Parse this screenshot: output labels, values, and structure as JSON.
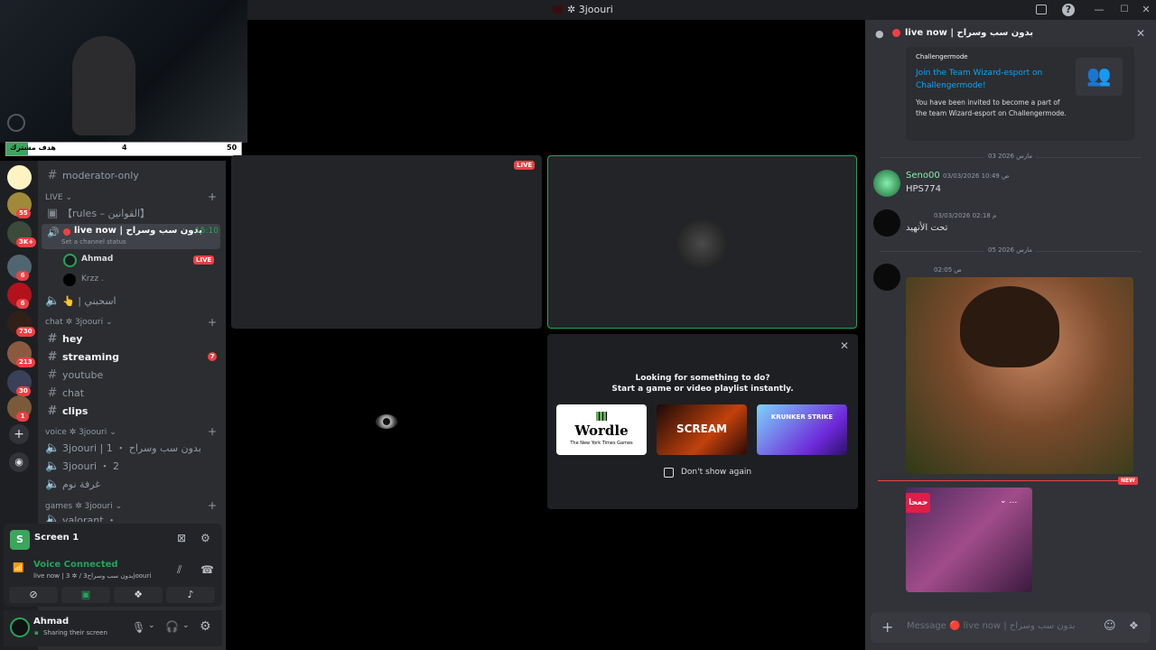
{
  "window": {
    "title": "✲ 3joouri"
  },
  "subscriber_bar": {
    "label": "هدف مشترك",
    "current": "4",
    "goal": "50"
  },
  "rail": {
    "servers": [
      {
        "color": "#fff3c4",
        "badge": ""
      },
      {
        "color": "#a08a3a",
        "badge": "55"
      },
      {
        "color": "#3b4a3a",
        "badge": "3K+"
      },
      {
        "color": "#4f6670",
        "badge": "6"
      },
      {
        "color": "#b2121b",
        "badge": "6"
      },
      {
        "color": "#2f2018",
        "badge": "730"
      },
      {
        "color": "#8a5a40",
        "badge": "213"
      },
      {
        "color": "#3a4058",
        "badge": "30"
      },
      {
        "color": "#7a5a3a",
        "badge": "1"
      }
    ]
  },
  "sidebar": {
    "channels": {
      "moderator": "moderator-only",
      "live_category": "LIVE",
      "rules": "【rules – القوانين】",
      "live_now_label": "live now | بدون سب وسراح",
      "live_now_time": "15:10",
      "set_status": "Set a channel status",
      "user1": "Ahmad",
      "user1_badge": "LIVE",
      "user2": "Krzz .",
      "clap": "👆 | اسحبني",
      "chat_category": "chat ✲ 3joouri",
      "hey": "hey",
      "streaming": "streaming",
      "streaming_badge": "7",
      "youtube": "youtube",
      "chat": "chat",
      "clips": "clips",
      "voice_category": "voice ✲ 3joouri",
      "voice1": "3joouri | 1 ・ بدون سب وسراح",
      "voice2": "3joouri ・ 2",
      "voice3": "غرفة نوم",
      "games_category": "games ✲ 3joouri",
      "valorant": "valorant ・"
    }
  },
  "voice_panel": {
    "screen_label": "Screen 1",
    "status": "Voice Connected",
    "channel": "live now | 3 ✲ / بدون سب وسراح3joouri"
  },
  "user_panel": {
    "name": "Ahmad",
    "status": "Sharing their screen"
  },
  "stage": {
    "live_badge": "LIVE",
    "activity_title": "Looking for something to do?",
    "activity_sub": "Start a game or video playlist instantly.",
    "activity_cards": [
      {
        "label": "Wordle",
        "caption": "The New York Times Games"
      },
      {
        "label": "SCREAM",
        "caption": ""
      },
      {
        "label": "KRUNKER STRIKE",
        "caption": ""
      }
    ],
    "dont_show": "Don't show again"
  },
  "chat": {
    "header_title": "live now | بدون سب وسراح",
    "invite": {
      "brand": "Challengermode",
      "title": "Join the Team Wizard-esport on Challengermode!",
      "body": "You have been invited to become a part of the team Wizard-esport on Challengermode."
    },
    "date1": "03 مارس 2026",
    "msg1": {
      "name": "Seno00",
      "time": "03/03/2026 10:49 ص",
      "text": "HPS774"
    },
    "msg2": {
      "name": "·",
      "time": "03/03/2026 02:18 م",
      "text": "تحت الأنهيد"
    },
    "date2": "05 مارس 2026",
    "msg3": {
      "name": "·",
      "time": "02:05 ص"
    },
    "new_label": "NEW",
    "gif_label": "حعحا",
    "composer_placeholder": "Message 🔴 live now | بدون سب وسراح"
  },
  "colors": {
    "accent": "#5865f2",
    "green": "#23a55a",
    "red": "#f23f43",
    "link": "#00a8fc"
  }
}
